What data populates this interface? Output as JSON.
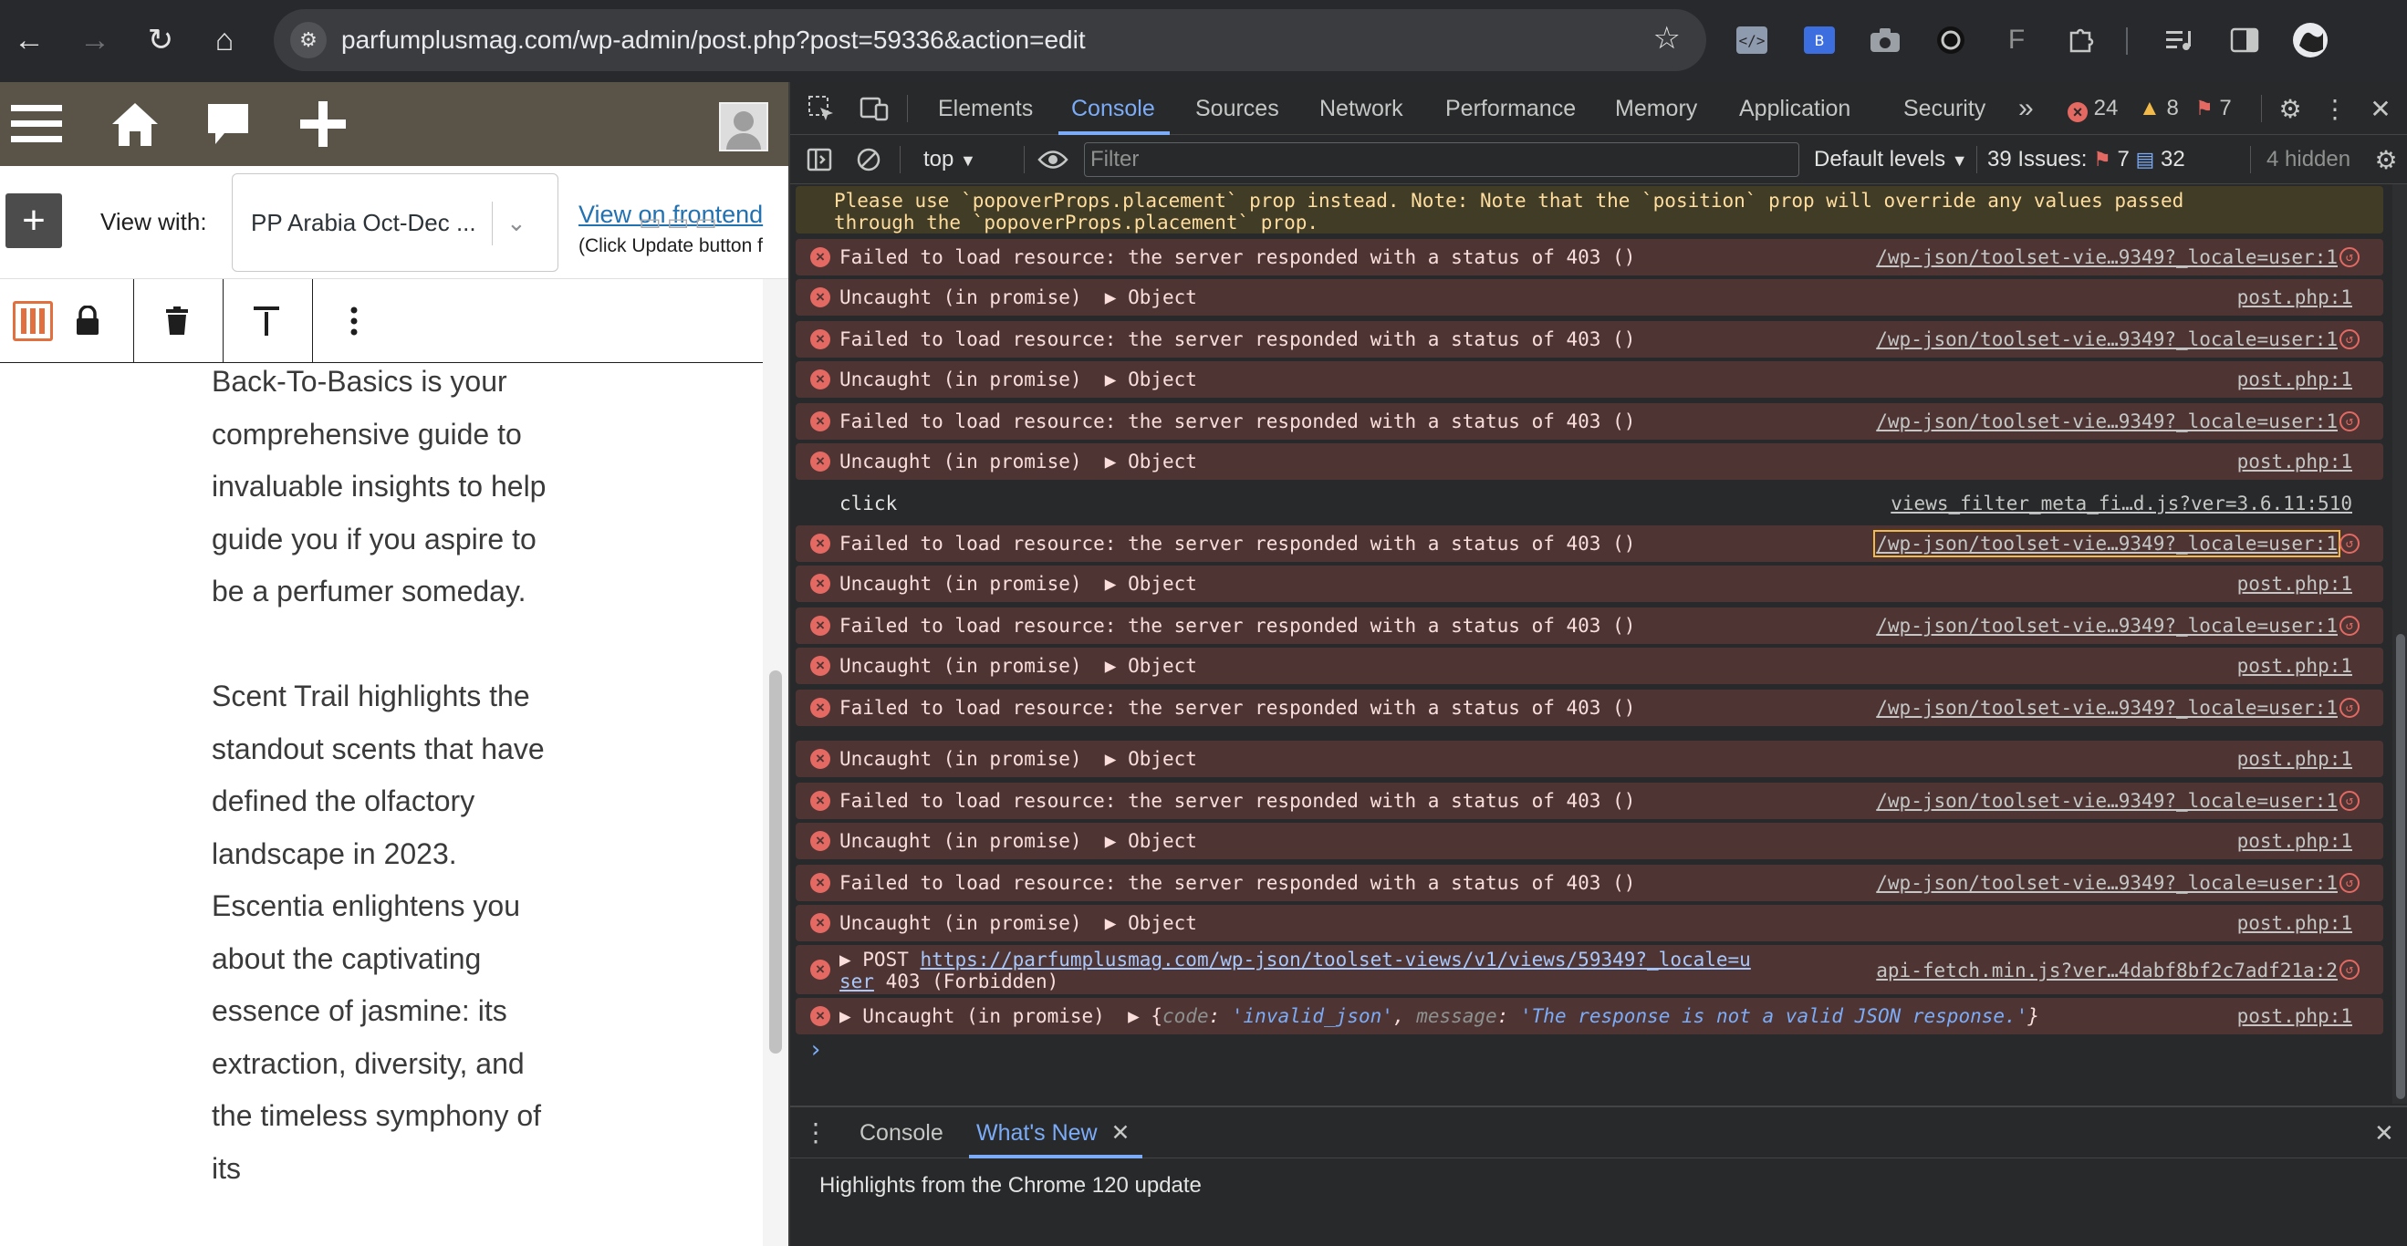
{
  "browser": {
    "url": "parfumplusmag.com/wp-admin/post.php?post=59336&action=edit",
    "nav": {
      "back": "←",
      "forward": "→",
      "reload": "↻",
      "home": "⌂"
    },
    "star": "☆",
    "extensions": [
      "code-icon",
      "translate-icon",
      "camera-icon",
      "circle-ext-icon",
      "f-ext-icon",
      "puzzle-icon",
      "media-icon",
      "sidebar-icon",
      "profile-avatar"
    ]
  },
  "wp": {
    "admin_bar": {
      "icons": [
        "menu-icon",
        "home-icon",
        "comment-icon",
        "plus-icon"
      ]
    },
    "toolbar": {
      "add_label": "+",
      "view_with_label": "View with:",
      "select_value": "PP Arabia Oct-Dec ...",
      "view_frontend_label": "View on frontend",
      "click_hint": "(Click Update button f"
    },
    "content": {
      "paragraphs": [
        "Back-To-Basics is your comprehensive guide to invaluable insights to help guide you if you aspire to be a perfumer someday.",
        "Scent Trail highlights the standout scents that have defined the olfactory landscape in 2023. Escentia enlightens you about the captivating essence of jasmine: its extraction, diversity, and the timeless symphony of its"
      ]
    }
  },
  "devtools": {
    "tabs": [
      "Elements",
      "Console",
      "Sources",
      "Network",
      "Performance",
      "Memory",
      "Application",
      "Security"
    ],
    "active_tab": "Console",
    "more": "»",
    "counts": {
      "errors": "24",
      "warnings": "8",
      "issues": "7"
    },
    "toolbar": {
      "context": "top",
      "filter_placeholder": "Filter",
      "levels": "Default levels",
      "issues_label": "39 Issues:",
      "issues_err": "7",
      "issues_info": "32",
      "hidden": "4 hidden"
    },
    "warn_line1": "Please use `popoverProps.placement` prop instead. Note: Note that the `position` prop will override any values passed",
    "warn_line2": "through the `popoverProps.placement` prop.",
    "msg_403": "Failed to load resource: the server responded with a status of 403 ()",
    "msg_uncaught": "Uncaught (in promise)  ▶ Object",
    "src_api": "/wp-json/toolset-vie…9349?_locale=user:1",
    "src_post": "post.php:1",
    "click_msg": "click",
    "click_src": "views_filter_meta_fi…d.js?ver=3.6.11:510",
    "post_prefix": "▶ POST ",
    "post_url": "https://parfumplusmag.com/wp-json/toolset-views/v1/views/59349?_locale=u",
    "post_url2": "ser",
    "post_status": " 403 (Forbidden)",
    "post_src": "api-fetch.min.js?ver…4dabf8bf2c7adf21a:2",
    "last_prefix": "▶ Uncaught (in promise)  ▶ {",
    "last_key1": "code",
    "last_val1": "'invalid_json'",
    "last_key2": "message",
    "last_val2": "'The response is not a valid JSON response.'",
    "prompt": "›",
    "drawer": {
      "tabs": [
        "Console",
        "What's New"
      ],
      "active": "What's New",
      "body": "Highlights from the Chrome 120 update"
    }
  }
}
